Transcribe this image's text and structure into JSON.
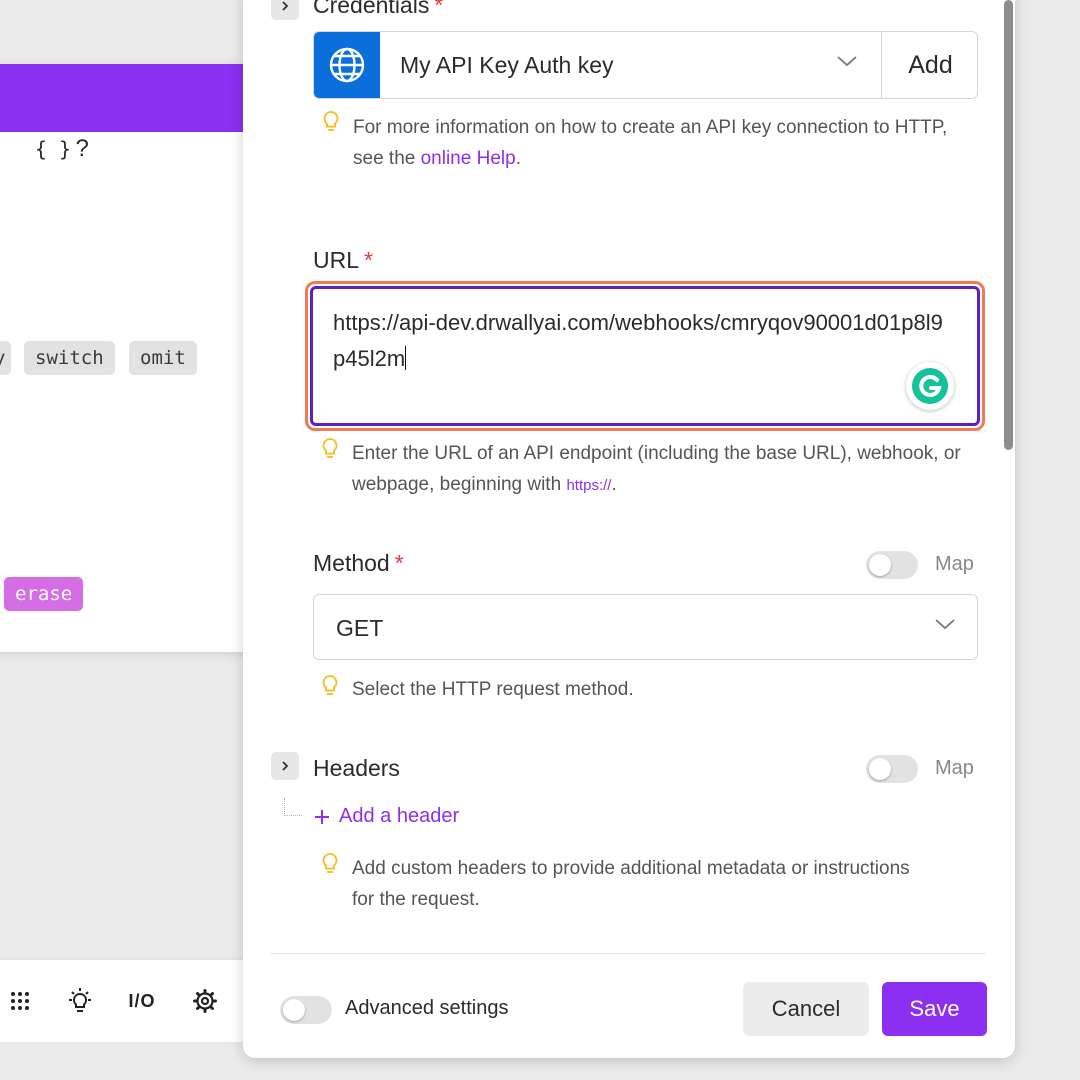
{
  "function_panel": {
    "toolbar_icons": [
      "calendar-icon",
      "table-icon",
      "braces-icon",
      "help-icon",
      "close-icon"
    ],
    "help_glyph": "?",
    "chips": {
      "partial": "y",
      "switch": "switch",
      "omit": "omit",
      "erase": "erase"
    }
  },
  "bottom_toolbar": {
    "icons": [
      "grid-dots-icon",
      "lightbulb-icon",
      "io-icon",
      "settings-icon"
    ],
    "io_label": "I/O"
  },
  "credentials": {
    "label": "Credentials",
    "value": "My API Key Auth key",
    "add_label": "Add",
    "hint_prefix": "For more information on how to create an API key connection to HTTP, see the ",
    "hint_link": "online Help",
    "hint_suffix": "."
  },
  "url": {
    "label": "URL",
    "value": "https://api-dev.drwallyai.com/webhooks/cmryqov90001d01p8l9p45l2m",
    "hint_prefix": "Enter the URL of an API endpoint (including the base URL), webhook, or webpage, beginning with ",
    "hint_code": "https://",
    "hint_suffix": "."
  },
  "method": {
    "label": "Method",
    "map_label": "Map",
    "map_enabled": false,
    "value": "GET",
    "hint": "Select the HTTP request method."
  },
  "headers": {
    "label": "Headers",
    "map_label": "Map",
    "map_enabled": false,
    "add_label": "Add a header",
    "hint": "Add custom headers to provide additional metadata or instructions for the request."
  },
  "footer": {
    "advanced_label": "Advanced settings",
    "advanced_enabled": false,
    "cancel_label": "Cancel",
    "save_label": "Save"
  },
  "colors": {
    "accent": "#8b2ff0",
    "required": "#e33b3b",
    "focus_outline": "#f07a55",
    "credential_icon_bg": "#0a6fdb",
    "grammarly": "#15c39a"
  }
}
